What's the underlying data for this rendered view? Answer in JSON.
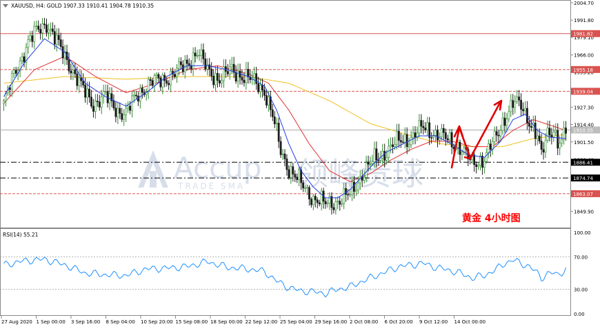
{
  "header": {
    "symbol_line": "XAUUSD, H4:  GOLD  1907.33 1910.41 1904.78 1910.35"
  },
  "annotation": {
    "text": "黄金   4小时图",
    "color": "#ff0000"
  },
  "watermark": {
    "latin": "Accup",
    "tagline": "TRADE SMA",
    "chinese": "领峰贵球"
  },
  "chart_data": [
    {
      "type": "candlestick",
      "instrument": "XAUUSD, H4",
      "ylim": [
        1840.0,
        2004.7
      ],
      "y_ticks": [
        2004.7,
        1991.8,
        1979.1,
        1966.0,
        1953.2,
        1940.1,
        1927.3,
        1914.4,
        1901.5,
        1888.4,
        1875.8,
        1862.7,
        1849.9
      ],
      "x_ticks": [
        "27 Aug 2020",
        "1 Sep 00:00",
        "3 Sep 16:00",
        "8 Sep 04:00",
        "10 Sep 20:00",
        "15 Sep 08:00",
        "18 Sep 00:00",
        "22 Sep 12:00",
        "25 Sep 04:00",
        "29 Sep 16:00",
        "2 Oct 08:00",
        "6 Oct 20:00",
        "9 Oct 12:00",
        "14 Oct 00:00"
      ],
      "horizontal_levels": [
        {
          "value": 1981.82,
          "style": "solid",
          "color": "#d9534f"
        },
        {
          "value": 1955.18,
          "style": "dashed",
          "color": "#d9534f"
        },
        {
          "value": 1939.04,
          "style": "dashed",
          "color": "#d9534f"
        },
        {
          "value": 1886.41,
          "style": "dashdot",
          "color": "#000000"
        },
        {
          "value": 1874.74,
          "style": "dashdot",
          "color": "#000000"
        },
        {
          "value": 1863.07,
          "style": "dashed",
          "color": "#d9534f"
        }
      ],
      "current_price": {
        "value": 1910.35
      },
      "series_anchors": {
        "close": [
          [
            0,
            1930
          ],
          [
            6,
            1955
          ],
          [
            12,
            1975
          ],
          [
            17,
            1985
          ],
          [
            21,
            1990
          ],
          [
            26,
            1975
          ],
          [
            32,
            1960
          ],
          [
            38,
            1942
          ],
          [
            44,
            1930
          ],
          [
            50,
            1935
          ],
          [
            56,
            1925
          ],
          [
            60,
            1922
          ],
          [
            66,
            1938
          ],
          [
            72,
            1945
          ],
          [
            78,
            1948
          ],
          [
            84,
            1952
          ],
          [
            90,
            1960
          ],
          [
            95,
            1968
          ],
          [
            100,
            1955
          ],
          [
            106,
            1948
          ],
          [
            112,
            1955
          ],
          [
            118,
            1950
          ],
          [
            124,
            1945
          ],
          [
            128,
            1940
          ],
          [
            132,
            1920
          ],
          [
            136,
            1895
          ],
          [
            140,
            1882
          ],
          [
            146,
            1870
          ],
          [
            152,
            1860
          ],
          [
            158,
            1855
          ],
          [
            164,
            1858
          ],
          [
            170,
            1862
          ],
          [
            176,
            1878
          ],
          [
            182,
            1888
          ],
          [
            188,
            1895
          ],
          [
            194,
            1902
          ],
          [
            200,
            1905
          ],
          [
            206,
            1912
          ],
          [
            212,
            1908
          ],
          [
            218,
            1903
          ],
          [
            224,
            1898
          ],
          [
            230,
            1885
          ],
          [
            236,
            1890
          ],
          [
            242,
            1905
          ],
          [
            246,
            1920
          ],
          [
            250,
            1930
          ],
          [
            254,
            1928
          ],
          [
            258,
            1918
          ],
          [
            262,
            1905
          ],
          [
            264,
            1890
          ],
          [
            267,
            1908
          ],
          [
            270,
            1912
          ],
          [
            272,
            1902
          ],
          [
            274,
            1900
          ],
          [
            276,
            1910
          ]
        ],
        "ma_blue": [
          [
            0,
            1935
          ],
          [
            10,
            1960
          ],
          [
            20,
            1978
          ],
          [
            30,
            1968
          ],
          [
            40,
            1945
          ],
          [
            50,
            1935
          ],
          [
            60,
            1928
          ],
          [
            70,
            1938
          ],
          [
            80,
            1950
          ],
          [
            90,
            1958
          ],
          [
            100,
            1958
          ],
          [
            110,
            1955
          ],
          [
            120,
            1950
          ],
          [
            128,
            1943
          ],
          [
            134,
            1925
          ],
          [
            140,
            1900
          ],
          [
            146,
            1880
          ],
          [
            152,
            1868
          ],
          [
            158,
            1860
          ],
          [
            164,
            1860
          ],
          [
            170,
            1866
          ],
          [
            176,
            1876
          ],
          [
            182,
            1886
          ],
          [
            188,
            1894
          ],
          [
            196,
            1900
          ],
          [
            204,
            1906
          ],
          [
            212,
            1906
          ],
          [
            220,
            1900
          ],
          [
            228,
            1892
          ],
          [
            236,
            1890
          ],
          [
            244,
            1902
          ],
          [
            250,
            1918
          ],
          [
            256,
            1922
          ],
          [
            262,
            1910
          ],
          [
            268,
            1905
          ],
          [
            276,
            1904
          ]
        ],
        "ma_red": [
          [
            0,
            1930
          ],
          [
            15,
            1955
          ],
          [
            30,
            1965
          ],
          [
            45,
            1950
          ],
          [
            60,
            1938
          ],
          [
            75,
            1945
          ],
          [
            90,
            1955
          ],
          [
            105,
            1958
          ],
          [
            120,
            1952
          ],
          [
            130,
            1945
          ],
          [
            140,
            1925
          ],
          [
            150,
            1900
          ],
          [
            160,
            1880
          ],
          [
            170,
            1872
          ],
          [
            180,
            1878
          ],
          [
            190,
            1888
          ],
          [
            200,
            1896
          ],
          [
            210,
            1902
          ],
          [
            220,
            1902
          ],
          [
            230,
            1898
          ],
          [
            240,
            1898
          ],
          [
            250,
            1910
          ],
          [
            260,
            1918
          ],
          [
            268,
            1914
          ],
          [
            276,
            1910
          ]
        ],
        "ma_yellow": [
          [
            0,
            1945
          ],
          [
            30,
            1950
          ],
          [
            60,
            1948
          ],
          [
            90,
            1950
          ],
          [
            120,
            1950
          ],
          [
            140,
            1945
          ],
          [
            160,
            1932
          ],
          [
            180,
            1915
          ],
          [
            200,
            1906
          ],
          [
            215,
            1900
          ],
          [
            230,
            1898
          ],
          [
            245,
            1898
          ],
          [
            260,
            1904
          ],
          [
            276,
            1907
          ]
        ]
      }
    },
    {
      "type": "line",
      "title": "RSI(14) 55.21",
      "ylim": [
        0,
        100
      ],
      "y_ticks": [
        100.0,
        70.0,
        30.0,
        0.0
      ],
      "levels": [
        70,
        30
      ],
      "x": "shared with price pane",
      "anchors": [
        [
          0,
          60
        ],
        [
          10,
          65
        ],
        [
          20,
          67
        ],
        [
          30,
          60
        ],
        [
          40,
          50
        ],
        [
          50,
          48
        ],
        [
          60,
          47
        ],
        [
          70,
          55
        ],
        [
          80,
          56
        ],
        [
          90,
          58
        ],
        [
          100,
          64
        ],
        [
          110,
          57
        ],
        [
          120,
          55
        ],
        [
          128,
          52
        ],
        [
          134,
          40
        ],
        [
          140,
          32
        ],
        [
          146,
          28
        ],
        [
          152,
          27
        ],
        [
          158,
          25
        ],
        [
          164,
          30
        ],
        [
          170,
          33
        ],
        [
          176,
          40
        ],
        [
          182,
          46
        ],
        [
          188,
          52
        ],
        [
          194,
          58
        ],
        [
          200,
          60
        ],
        [
          206,
          62
        ],
        [
          212,
          57
        ],
        [
          218,
          54
        ],
        [
          224,
          50
        ],
        [
          230,
          44
        ],
        [
          236,
          47
        ],
        [
          242,
          55
        ],
        [
          246,
          62
        ],
        [
          250,
          66
        ],
        [
          254,
          62
        ],
        [
          258,
          58
        ],
        [
          262,
          50
        ],
        [
          264,
          44
        ],
        [
          267,
          49
        ],
        [
          270,
          50
        ],
        [
          272,
          48
        ],
        [
          274,
          51
        ],
        [
          276,
          55
        ]
      ],
      "color": "#1e90ff"
    }
  ],
  "colors": {
    "bull": "#2e8b2e",
    "bear": "#1a1a1a",
    "ma_blue": "#1f3fe0",
    "ma_red": "#e03030",
    "ma_yellow": "#f0c020",
    "rsi": "#1e90ff",
    "level_red": "#d9534f",
    "current": "#aaaaaa"
  }
}
